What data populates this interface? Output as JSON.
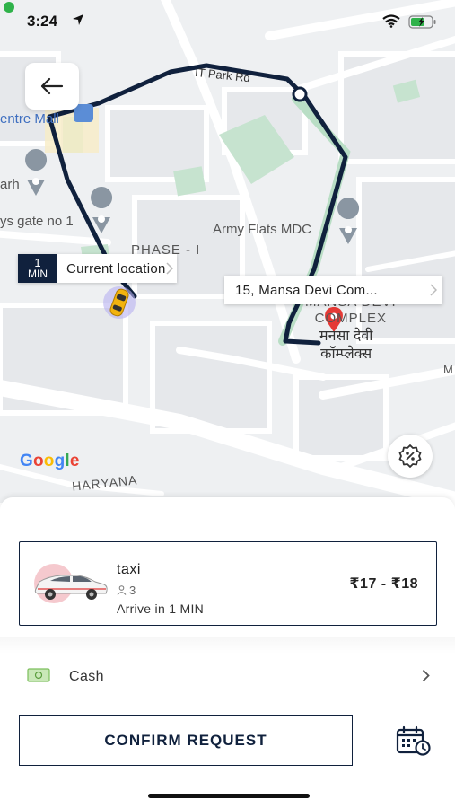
{
  "status_bar": {
    "time": "3:24"
  },
  "map": {
    "labels": {
      "it_park_rd": "IT Park Rd",
      "centre_mall": "entre Mall",
      "arh": "arh",
      "ys_gate": "ys gate no 1",
      "army_flats": "Army Flats MDC",
      "phase": "PHASE - I",
      "mansa_devi_complex": "MANSA DEVI\nCOMPLEX",
      "mansa_devi_hindi": "मनसा देवी\nकॉम्प्लेक्स",
      "haryana": "HARYANA",
      "m_right": "M"
    },
    "eta_bubble": {
      "minutes": "1",
      "unit": "MIN",
      "text": "Current location"
    },
    "destination_bubble": {
      "text": "15,  Mansa Devi Com..."
    },
    "google_logo": "Google",
    "colors": {
      "route": "#10213d",
      "pin": "#e53935",
      "car": "#f2b30f"
    }
  },
  "ride_option": {
    "name": "taxi",
    "seats": "3",
    "arrival": "Arrive in 1 MIN",
    "price": "₹17 - ₹18"
  },
  "payment": {
    "method": "Cash"
  },
  "actions": {
    "confirm_label": "CONFIRM REQUEST"
  },
  "icons": {
    "back": "arrow-left-icon",
    "promo": "percent-badge-icon",
    "cash": "cash-icon",
    "schedule": "calendar-clock-icon"
  },
  "theme": {
    "primary": "#10213d",
    "accent_green": "#2fb24a"
  }
}
